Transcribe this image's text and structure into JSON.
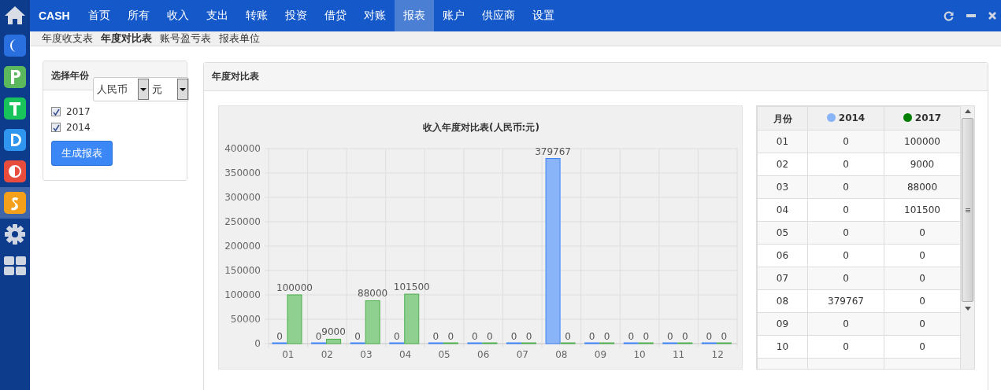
{
  "sidebar": {
    "apps": [
      {
        "kind": "home",
        "selected": false
      },
      {
        "kind": "c",
        "color": "#2a6fe0",
        "selected": false
      },
      {
        "kind": "p",
        "color": "#5cb85c",
        "selected": false
      },
      {
        "kind": "t",
        "color": "#19c35b",
        "selected": false
      },
      {
        "kind": "d",
        "color": "#2f95ef",
        "selected": false
      },
      {
        "kind": "half",
        "color": "#e84c3d",
        "selected": false
      },
      {
        "kind": "s",
        "color": "#f5a01a",
        "selected": true
      },
      {
        "kind": "gear",
        "selected": false
      },
      {
        "kind": "grid",
        "selected": false
      }
    ]
  },
  "topbar": {
    "brand": "CASH",
    "menu": [
      {
        "label": "首页",
        "selected": false
      },
      {
        "label": "所有",
        "selected": false
      },
      {
        "label": "收入",
        "selected": false
      },
      {
        "label": "支出",
        "selected": false
      },
      {
        "label": "转账",
        "selected": false
      },
      {
        "label": "投资",
        "selected": false
      },
      {
        "label": "借贷",
        "selected": false
      },
      {
        "label": "对账",
        "selected": false
      },
      {
        "label": "报表",
        "selected": true
      },
      {
        "label": "账户",
        "selected": false
      },
      {
        "label": "供应商",
        "selected": false
      },
      {
        "label": "设置",
        "selected": false
      }
    ]
  },
  "subnav": [
    {
      "label": "年度收支表",
      "selected": false
    },
    {
      "label": "年度对比表",
      "selected": true
    },
    {
      "label": "账号盈亏表",
      "selected": false
    },
    {
      "label": "报表单位",
      "selected": false
    }
  ],
  "year_panel": {
    "title": "选择年份",
    "currency": "人民币",
    "unit": "元",
    "years": [
      {
        "label": "2017",
        "checked": true
      },
      {
        "label": "2014",
        "checked": true
      }
    ],
    "button": "生成报表"
  },
  "report_panel": {
    "title": "年度对比表",
    "chart_data": {
      "type": "bar",
      "title": "收入年度对比表(人民币:元)",
      "categories": [
        "01",
        "02",
        "03",
        "04",
        "05",
        "06",
        "07",
        "08",
        "09",
        "10",
        "11",
        "12"
      ],
      "series": [
        {
          "color": "#8ab4f8",
          "values": [
            0,
            0,
            0,
            0,
            0,
            0,
            0,
            379767,
            0,
            0,
            0,
            0
          ]
        },
        {
          "color": "#8fcf8f",
          "values": [
            100000,
            9000,
            88000,
            101500,
            0,
            0,
            0,
            0,
            0,
            0,
            0,
            0
          ]
        }
      ],
      "ylim": [
        0,
        400000
      ],
      "yticks": [
        0,
        50000,
        100000,
        150000,
        200000,
        250000,
        300000,
        350000,
        400000
      ],
      "data_labels": true,
      "grid": true
    },
    "table": {
      "columns": [
        {
          "label": "月份"
        },
        {
          "label": "2014",
          "color": "#8ab4f8"
        },
        {
          "label": "2017",
          "color": "#008000"
        }
      ],
      "rows": [
        [
          "01",
          "0",
          "100000"
        ],
        [
          "02",
          "0",
          "9000"
        ],
        [
          "03",
          "0",
          "88000"
        ],
        [
          "04",
          "0",
          "101500"
        ],
        [
          "05",
          "0",
          "0"
        ],
        [
          "06",
          "0",
          "0"
        ],
        [
          "07",
          "0",
          "0"
        ],
        [
          "08",
          "379767",
          "0"
        ],
        [
          "09",
          "0",
          "0"
        ],
        [
          "10",
          "0",
          "0"
        ]
      ]
    }
  }
}
